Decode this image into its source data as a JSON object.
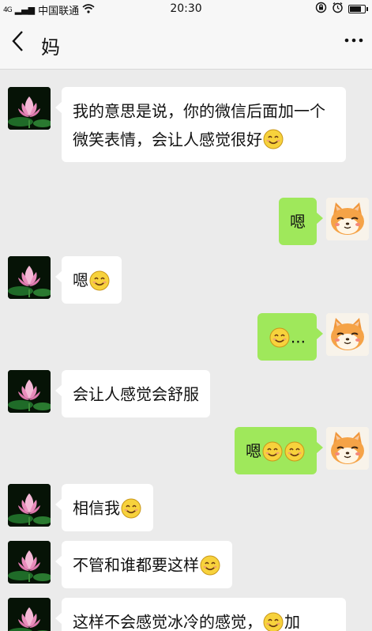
{
  "status_bar": {
    "carrier": "中国联通",
    "signal": "4G",
    "time": "20:30"
  },
  "header": {
    "back_label": "<",
    "title": "妈",
    "more_label": "···"
  },
  "messages": [
    {
      "sender": "mom",
      "text": "我的意思是说，你的微信后面加一个微笑表情，会让人感觉很好",
      "emoji": "smile"
    },
    {
      "sender": "me",
      "text": "嗯"
    },
    {
      "sender": "mom",
      "text": "嗯",
      "emoji": "smile"
    },
    {
      "sender": "me",
      "text": "...",
      "emoji_before": "smile"
    },
    {
      "sender": "mom",
      "text": "会让人感觉会舒服"
    },
    {
      "sender": "me",
      "text": "嗯",
      "emoji_count": 2
    },
    {
      "sender": "mom",
      "text": "相信我",
      "emoji": "smile"
    },
    {
      "sender": "mom",
      "text": "不管和谁都要这样",
      "emoji": "smile"
    },
    {
      "sender": "mom",
      "text": "这样不会感觉冰冷的感觉，",
      "emoji": "smile",
      "tail": "加"
    }
  ],
  "colors": {
    "bg": "#ebebeb",
    "self_bubble": "#9fe85b",
    "other_bubble": "#ffffff"
  },
  "icons": {
    "avatar_mom": "lotus-avatar",
    "avatar_me": "cartoon-cat-avatar",
    "emoji": "smile-emoji"
  }
}
